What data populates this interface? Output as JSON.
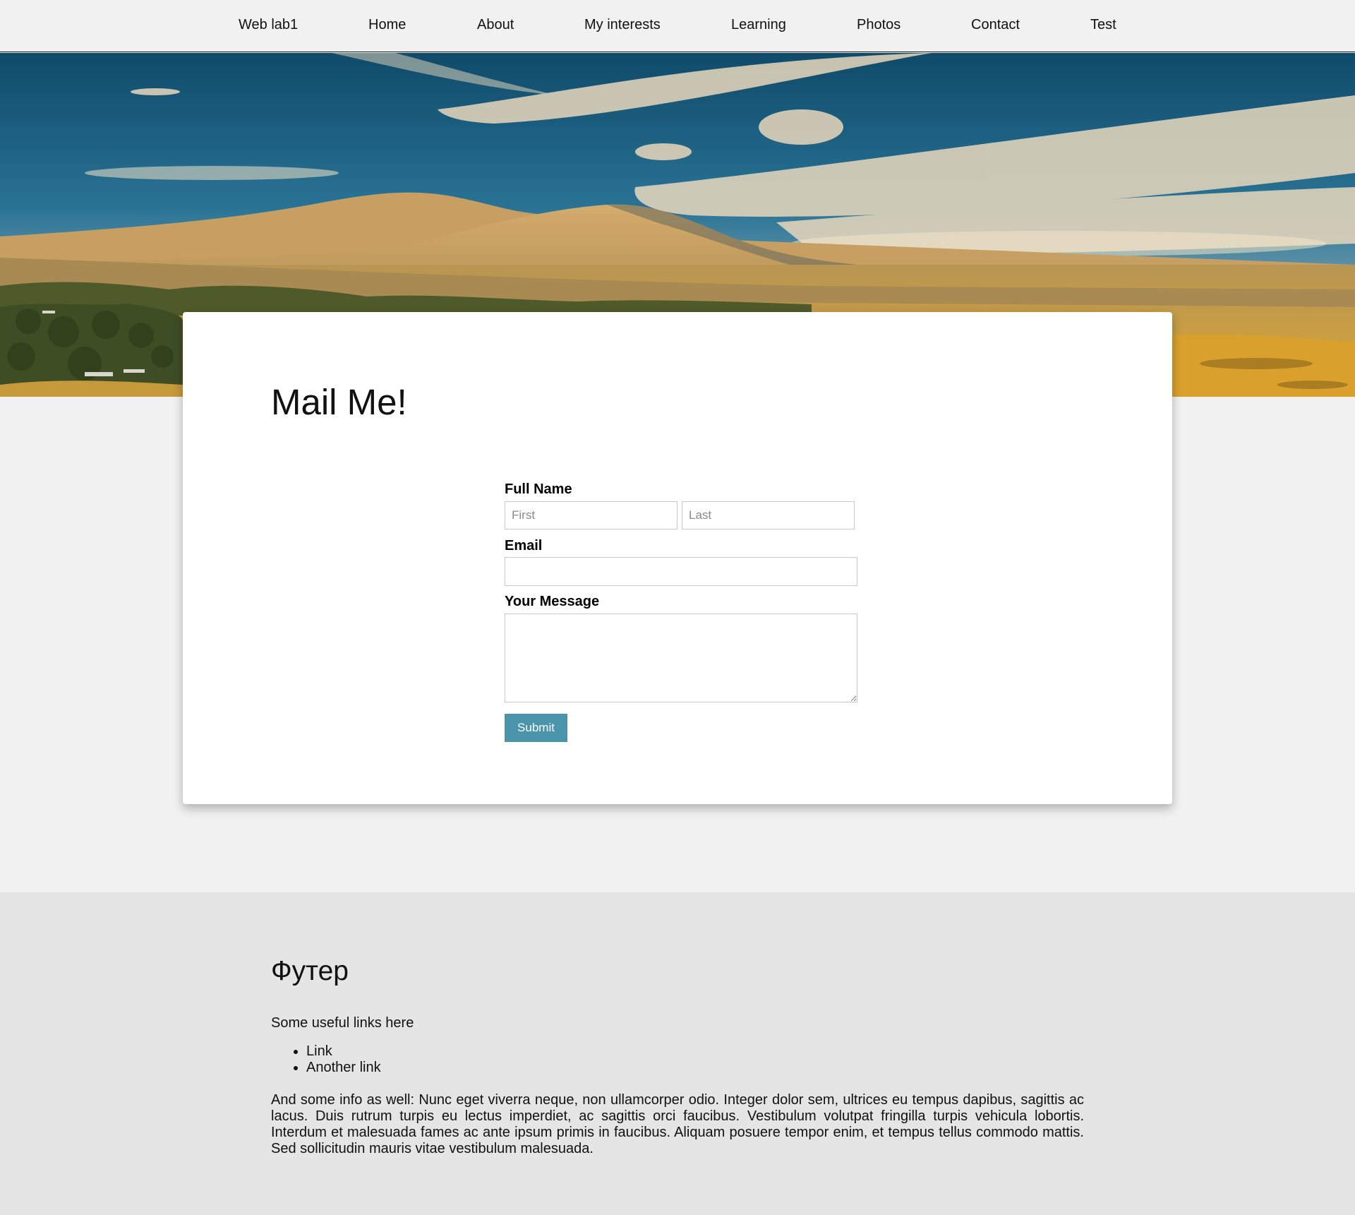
{
  "nav": {
    "items": [
      {
        "label": "Web lab1"
      },
      {
        "label": "Home"
      },
      {
        "label": "About"
      },
      {
        "label": "My interests"
      },
      {
        "label": "Learning"
      },
      {
        "label": "Photos"
      },
      {
        "label": "Contact"
      },
      {
        "label": "Test"
      }
    ]
  },
  "hero": {
    "image": "landscape-hills-under-cloudy-sky"
  },
  "form": {
    "title": "Mail Me!",
    "full_name_label": "Full Name",
    "first_placeholder": "First",
    "last_placeholder": "Last",
    "first_value": "",
    "last_value": "",
    "email_label": "Email",
    "email_value": "",
    "message_label": "Your Message",
    "message_value": "",
    "submit_label": "Submit"
  },
  "footer": {
    "title": "Футер",
    "intro": "Some useful links here",
    "links": [
      {
        "label": "Link"
      },
      {
        "label": "Another link"
      }
    ],
    "info": "And some info as well: Nunc eget viverra neque, non ullamcorper odio. Integer dolor sem, ultrices eu tempus dapibus, sagittis ac lacus. Duis rutrum turpis eu lectus imperdiet, ac sagittis orci faucibus. Vestibulum volutpat fringilla turpis vehicula lobortis. Interdum et malesuada fames ac ante ipsum primis in faucibus. Aliquam posuere tempor enim, et tempus tellus commodo mattis. Sed sollicitudin mauris vitae vestibulum malesuada."
  },
  "colors": {
    "page_bg": "#f1f1f1",
    "footer_bg": "#e5e5e5",
    "submit_bg": "#4a95ab",
    "sky": "#1e5f7e",
    "hills": "#c9a15f"
  }
}
